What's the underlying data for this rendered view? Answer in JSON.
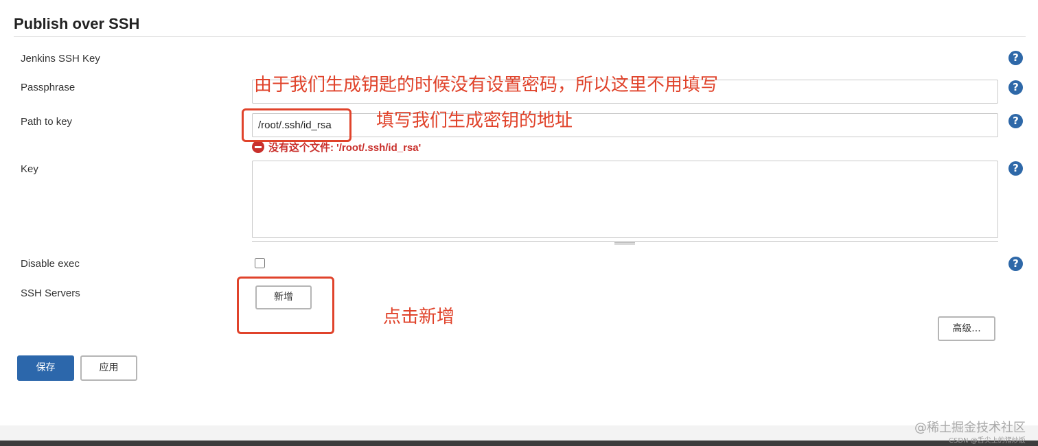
{
  "section": {
    "title": "Publish over SSH"
  },
  "fields": {
    "jenkins_ssh_key": {
      "label": "Jenkins SSH Key"
    },
    "passphrase": {
      "label": "Passphrase",
      "value": ""
    },
    "path_to_key": {
      "label": "Path to key",
      "value": "/root/.ssh/id_rsa",
      "error": "没有这个文件: '/root/.ssh/id_rsa'"
    },
    "key": {
      "label": "Key",
      "value": ""
    },
    "disable_exec": {
      "label": "Disable exec",
      "checked": false
    },
    "ssh_servers": {
      "label": "SSH Servers",
      "add_label": "新增"
    }
  },
  "help_icon_glyph": "?",
  "buttons": {
    "advanced": "高级...",
    "save": "保存",
    "apply": "应用"
  },
  "annotations": {
    "passphrase_note": "由于我们生成钥匙的时候没有设置密码，所以这里不用填写",
    "path_note": "填写我们生成密钥的地址",
    "add_note": "点击新增",
    "color": "#e0432b"
  },
  "watermark": {
    "main": "@稀土掘金技术社区",
    "sub": "CSDN @舌尖上的猪炒饭"
  },
  "icons": {
    "help": "help-icon",
    "error": "error-icon"
  },
  "colors": {
    "primary_button": "#2c67ab",
    "help_icon": "#2e68a8",
    "error": "#c9302c"
  }
}
